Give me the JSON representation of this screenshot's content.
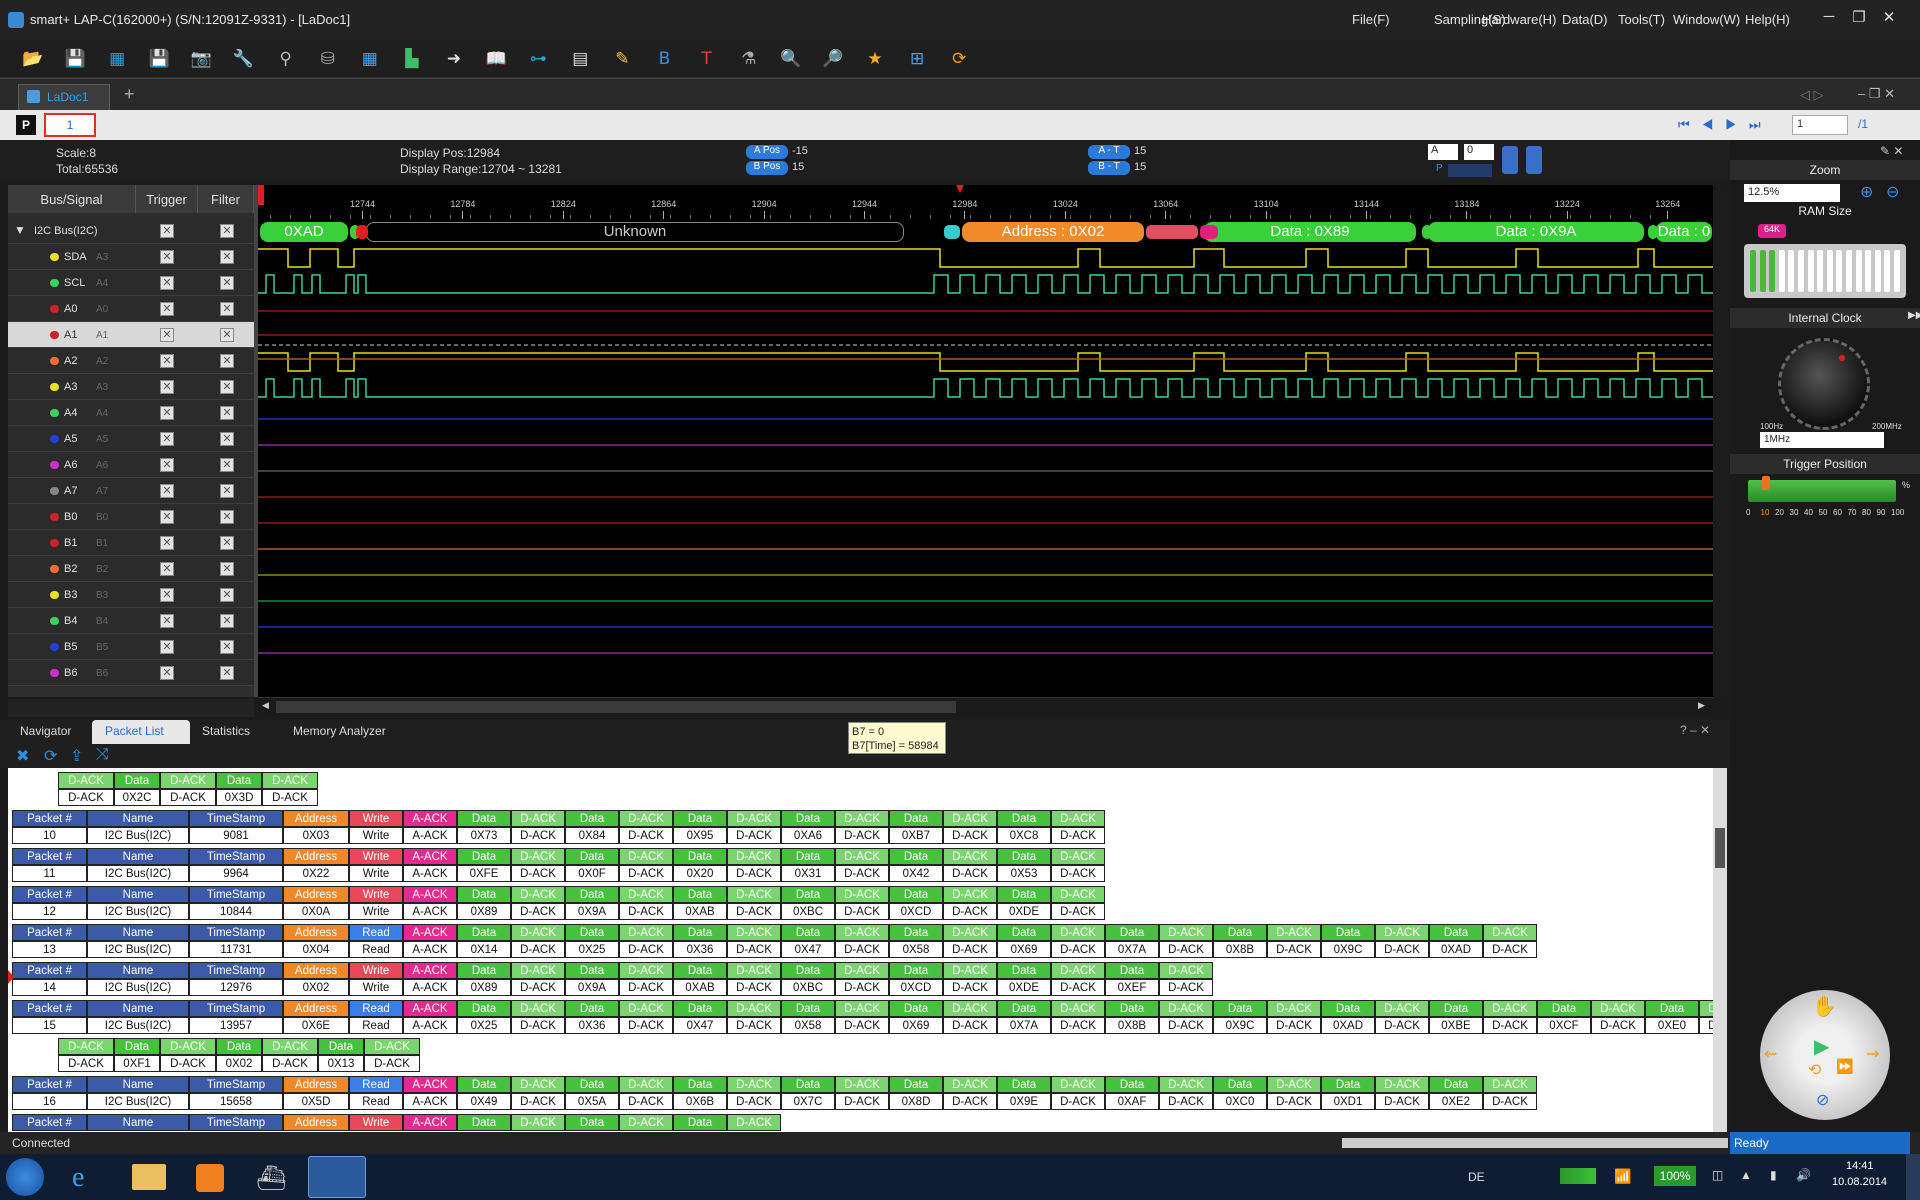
{
  "app": {
    "title": "smart+  LAP-C(162000+) (S/N:12091Z-9331) - [LaDoc1]",
    "menus": [
      "File(F)",
      "Sampling(S)",
      "Hardware(H)",
      "Data(D)",
      "Tools(T)",
      "Window(W)",
      "Help(H)"
    ],
    "window_buttons": [
      "─",
      "❐",
      "✕"
    ]
  },
  "toolbar": {
    "icons": [
      {
        "name": "open-folder-icon",
        "glyph": "📂",
        "color": "#f0a830"
      },
      {
        "name": "save-icon",
        "glyph": "💾",
        "color": "#3a8ee0"
      },
      {
        "name": "save-all-icon",
        "glyph": "▦",
        "color": "#2a9fd6"
      },
      {
        "name": "save-as-icon",
        "glyph": "💾",
        "color": "#4aa0e8"
      },
      {
        "name": "camera-icon",
        "glyph": "📷",
        "color": "#5aa8e8"
      },
      {
        "name": "tools-icon",
        "glyph": "🔧",
        "color": "#4a90d9"
      },
      {
        "name": "probe-icon",
        "glyph": "⚲",
        "color": "#bbbbbb"
      },
      {
        "name": "database-icon",
        "glyph": "⛁",
        "color": "#aaaaaa"
      },
      {
        "name": "grid-icon",
        "glyph": "▦",
        "color": "#4aa0e8"
      },
      {
        "name": "chart-icon",
        "glyph": "▙",
        "color": "#3ac06a"
      },
      {
        "name": "import-icon",
        "glyph": "➜",
        "color": "#dddddd"
      },
      {
        "name": "book-icon",
        "glyph": "📖",
        "color": "#4aa0e8"
      },
      {
        "name": "bus-icon",
        "glyph": "⊶",
        "color": "#2a9fd6"
      },
      {
        "name": "film-icon",
        "glyph": "▤",
        "color": "#dddddd"
      },
      {
        "name": "note-icon",
        "glyph": "✎",
        "color": "#f0c830"
      },
      {
        "name": "marker-b-icon",
        "glyph": "B",
        "color": "#3a8ee0"
      },
      {
        "name": "marker-t-icon",
        "glyph": "T",
        "color": "#e04030"
      },
      {
        "name": "bottle-icon",
        "glyph": "⚗",
        "color": "#aaaaaa"
      },
      {
        "name": "search-icon",
        "glyph": "🔍",
        "color": "#3ac06a"
      },
      {
        "name": "search-next-icon",
        "glyph": "🔎",
        "color": "#4aa0e8"
      },
      {
        "name": "star-icon",
        "glyph": "★",
        "color": "#f0b020"
      },
      {
        "name": "binary-icon",
        "glyph": "⊞",
        "color": "#4aa0e8"
      },
      {
        "name": "refresh-icon",
        "glyph": "⟳",
        "color": "#f0a020"
      }
    ]
  },
  "doc": {
    "tab_label": "LaDoc1",
    "add_tab": "+",
    "page_input": "1",
    "page_total": "/1",
    "left_page": "1"
  },
  "info": {
    "scale": "Scale:8",
    "total": "Total:65536",
    "display_pos": "Display Pos:12984",
    "display_range": "Display Range:12704 ~ 13281",
    "a_pos_label": "A Pos",
    "a_pos_value": "-15",
    "b_pos_label": "B Pos",
    "b_pos_value": "15",
    "a_t_label": "A - T",
    "a_t_value": "15",
    "b_t_label": "B - T",
    "b_t_value": "15",
    "cursor_sel": "A",
    "cursor_num": "0",
    "p_label": "P"
  },
  "signals": {
    "headers": {
      "bus": "Bus/Signal",
      "trigger": "Trigger",
      "filter": "Filter"
    },
    "bus_name": "I2C Bus(I2C)",
    "rows": [
      {
        "name": "SDA",
        "pin": "A3",
        "color": "#e8e020"
      },
      {
        "name": "SCL",
        "pin": "A4",
        "color": "#3ad060"
      },
      {
        "name": "A0",
        "pin": "A0",
        "color": "#d02020"
      },
      {
        "name": "A1",
        "pin": "A1",
        "color": "#d02020"
      },
      {
        "name": "A2",
        "pin": "A2",
        "color": "#f07030"
      },
      {
        "name": "A3",
        "pin": "A3",
        "color": "#e8e020"
      },
      {
        "name": "A4",
        "pin": "A4",
        "color": "#3ad060"
      },
      {
        "name": "A5",
        "pin": "A5",
        "color": "#2040e0"
      },
      {
        "name": "A6",
        "pin": "A6",
        "color": "#d030d0"
      },
      {
        "name": "A7",
        "pin": "A7",
        "color": "#888888"
      },
      {
        "name": "B0",
        "pin": "B0",
        "color": "#d02020"
      },
      {
        "name": "B1",
        "pin": "B1",
        "color": "#d02020"
      },
      {
        "name": "B2",
        "pin": "B2",
        "color": "#f07030"
      },
      {
        "name": "B3",
        "pin": "B3",
        "color": "#e8e020"
      },
      {
        "name": "B4",
        "pin": "B4",
        "color": "#3ad060"
      },
      {
        "name": "B5",
        "pin": "B5",
        "color": "#2040e0"
      },
      {
        "name": "B6",
        "pin": "B6",
        "color": "#d030d0"
      }
    ]
  },
  "ruler": {
    "ticks": [
      "12744",
      "12784",
      "12824",
      "12864",
      "12904",
      "12944",
      "12984",
      "13024",
      "13064",
      "13104",
      "13144",
      "13184",
      "13224",
      "13264"
    ]
  },
  "bus_decode": [
    "0XAD",
    "Unknown",
    "Address : 0X02",
    "Data : 0X89",
    "Data : 0X9A",
    "Data : 0"
  ],
  "right_panel": {
    "zoom": "Zoom",
    "zoom_value": "12.5%",
    "ram_size": "RAM Size",
    "ram_badge": "64K",
    "internal_clock": "Internal Clock",
    "clock_min": "100Hz",
    "clock_max": "200MHz",
    "clock_value": "1MHz",
    "trigger_position": "Trigger Position",
    "trigger_pct": "%",
    "trigger_scale": [
      "0",
      "10",
      "20",
      "30",
      "40",
      "50",
      "60",
      "70",
      "80",
      "90",
      "100"
    ]
  },
  "bottom_tabs": [
    "Navigator",
    "Packet List",
    "Statistics",
    "Memory Analyzer"
  ],
  "tooltip": {
    "line1": "B7 = 0",
    "line2": "B7[Time] = 58984"
  },
  "packets": {
    "hdr": {
      "packet": "Packet #",
      "name": "Name",
      "time": "TimeStamp"
    },
    "continuation_top": [
      [
        "D-ACK",
        "Data",
        "D-ACK",
        "Data",
        "D-ACK"
      ],
      [
        "D-ACK",
        "0X2C",
        "D-ACK",
        "0X3D",
        "D-ACK"
      ]
    ],
    "rows": [
      {
        "id": "10",
        "name": "I2C Bus(I2C)",
        "ts": "9081",
        "addr": "0X03",
        "rw": "Write",
        "bytes": [
          "0X73",
          "0X84",
          "0X95",
          "0XA6",
          "0XB7",
          "0XC8"
        ]
      },
      {
        "id": "11",
        "name": "I2C Bus(I2C)",
        "ts": "9964",
        "addr": "0X22",
        "rw": "Write",
        "bytes": [
          "0XFE",
          "0X0F",
          "0X20",
          "0X31",
          "0X42",
          "0X53"
        ]
      },
      {
        "id": "12",
        "name": "I2C Bus(I2C)",
        "ts": "10844",
        "addr": "0X0A",
        "rw": "Write",
        "bytes": [
          "0X89",
          "0X9A",
          "0XAB",
          "0XBC",
          "0XCD",
          "0XDE"
        ]
      },
      {
        "id": "13",
        "name": "I2C Bus(I2C)",
        "ts": "11731",
        "addr": "0X04",
        "rw": "Read",
        "bytes": [
          "0X14",
          "0X25",
          "0X36",
          "0X47",
          "0X58",
          "0X69",
          "0X7A",
          "0X8B",
          "0X9C",
          "0XAD"
        ]
      },
      {
        "id": "14",
        "name": "I2C Bus(I2C)",
        "ts": "12976",
        "addr": "0X02",
        "rw": "Write",
        "bytes": [
          "0X89",
          "0X9A",
          "0XAB",
          "0XBC",
          "0XCD",
          "0XDE",
          "0XEF"
        ]
      },
      {
        "id": "15",
        "name": "I2C Bus(I2C)",
        "ts": "13957",
        "addr": "0X6E",
        "rw": "Read",
        "bytes": [
          "0X25",
          "0X36",
          "0X47",
          "0X58",
          "0X69",
          "0X7A",
          "0X8B",
          "0X9C",
          "0XAD",
          "0XBE",
          "0XCF",
          "0XE0"
        ],
        "cont": [
          "0XF1",
          "0X02",
          "0X13"
        ]
      },
      {
        "id": "16",
        "name": "I2C Bus(I2C)",
        "ts": "15658",
        "addr": "0X5D",
        "rw": "Read",
        "bytes": [
          "0X49",
          "0X5A",
          "0X6B",
          "0X7C",
          "0X8D",
          "0X9E",
          "0XAF",
          "0XC0",
          "0XD1",
          "0XE2"
        ]
      }
    ],
    "partial": {
      "rw": "Write",
      "n": 3
    },
    "labels": {
      "address": "Address",
      "aack": "A-ACK",
      "data": "Data",
      "dack": "D-ACK"
    }
  },
  "status": {
    "left": "Connected",
    "right": "Ready"
  },
  "taskbar": {
    "lang": "DE",
    "battery": "100%",
    "time": "14:41",
    "date": "10.08.2014"
  }
}
